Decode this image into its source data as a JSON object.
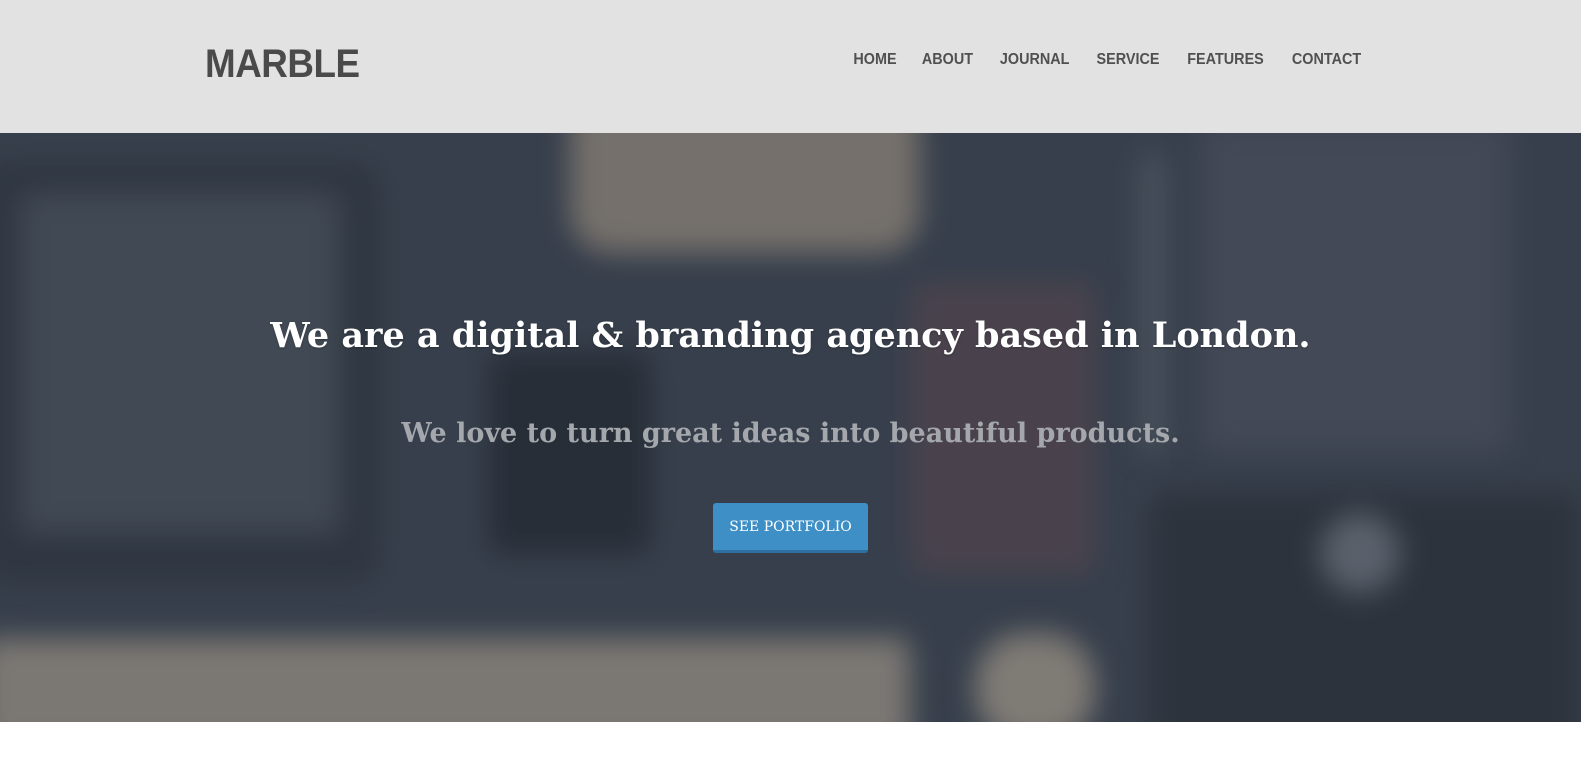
{
  "brand": {
    "name": "MARBLE"
  },
  "nav": {
    "items": [
      {
        "label": "HOME"
      },
      {
        "label": "ABOUT"
      },
      {
        "label": "JOURNAL"
      },
      {
        "label": "SERVICE"
      },
      {
        "label": "FEATURES"
      },
      {
        "label": "CONTACT"
      }
    ]
  },
  "hero": {
    "headline": "We are a digital & branding agency based in London.",
    "subheadline": "We love to turn great ideas into beautiful products.",
    "cta_label": "SEE PORTFOLIO"
  },
  "colors": {
    "header_bg": "#e2e2e2",
    "text_dark": "#4a4a4a",
    "accent": "#3e8fc6"
  }
}
